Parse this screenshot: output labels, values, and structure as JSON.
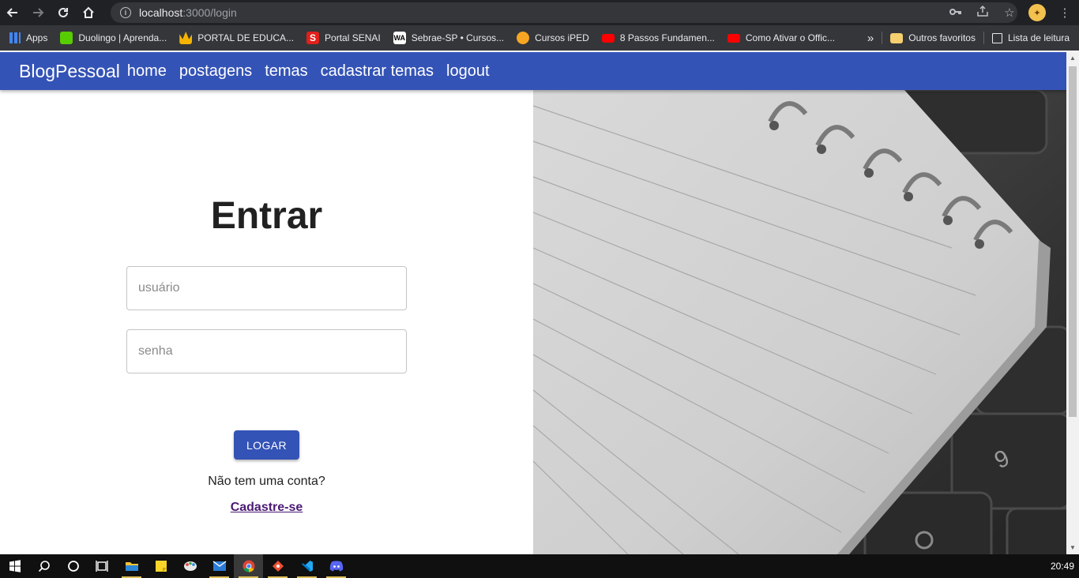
{
  "browser": {
    "url_host": "localhost",
    "url_path": ":3000/login",
    "bookmarks": [
      {
        "label": "Apps",
        "color": "#4285f4"
      },
      {
        "label": "Duolingo | Aprenda...",
        "color": "#58cc02"
      },
      {
        "label": "PORTAL DE EDUCA...",
        "color": "#f4b400"
      },
      {
        "label": "Portal SENAI",
        "color": "#e0201b"
      },
      {
        "label": "Sebrae-SP • Cursos...",
        "color": "#ffffff"
      },
      {
        "label": "Cursos iPED",
        "color": "#f6a623"
      },
      {
        "label": "8 Passos Fundamen...",
        "color": "#ff0000"
      },
      {
        "label": "Como Ativar o Offic...",
        "color": "#ff0000"
      }
    ],
    "overflow": "»",
    "other_favorites": "Outros favoritos",
    "reading_list": "Lista de leitura"
  },
  "appbar": {
    "brand": "BlogPessoal",
    "links": [
      "home",
      "postagens",
      "temas",
      "cadastrar temas",
      "logout"
    ],
    "color": "#3453b6"
  },
  "login": {
    "title": "Entrar",
    "username_placeholder": "usuário",
    "password_placeholder": "senha",
    "submit_label": "LOGAR",
    "question": "Não tem uma conta?",
    "signup_link": "Cadastre-se"
  },
  "taskbar": {
    "time": "20:49"
  }
}
